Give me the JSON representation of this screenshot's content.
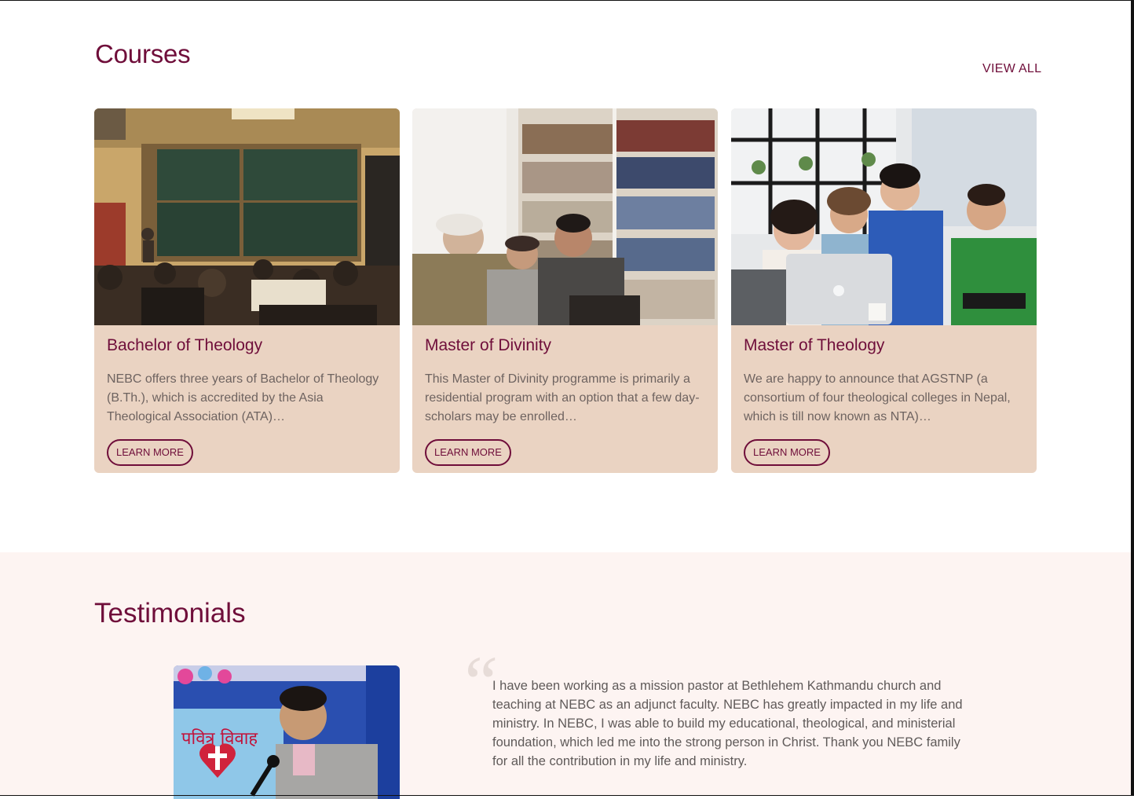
{
  "courses": {
    "title": "Courses",
    "view_all_label": "VIEW ALL",
    "items": [
      {
        "title": "Bachelor of Theology",
        "description": "NEBC offers three years of Bachelor of Theology (B.Th.), which is accredited by the Asia Theological Association (ATA)…",
        "button_label": "LEARN MORE"
      },
      {
        "title": "Master of Divinity",
        "description": "This Master of Divinity programme is primarily a residential program with an option that a few day-scholars may be enrolled…",
        "button_label": "LEARN MORE"
      },
      {
        "title": "Master of Theology",
        "description": "We are happy to announce that AGSTNP (a consortium of four theological colleges in Nepal, which is till now known as NTA)…",
        "button_label": "LEARN MORE"
      }
    ]
  },
  "testimonials": {
    "title": "Testimonials",
    "quote_mark": "“",
    "quote": "I have been working as a mission pastor at Bethlehem Kathmandu church and teaching at NEBC as an adjunct faculty. NEBC has greatly impacted in my life and ministry. In NEBC, I was able to build my educational, theological, and ministerial foundation, which led me into the strong person in Christ. Thank you NEBC family for all the contribution in my life and ministry.",
    "photo_banner_text": "पवित्र विवाह"
  },
  "colors": {
    "brand": "#6f0e3a",
    "card_bg": "#ead3c2",
    "testimonial_bg": "#fdf4f2",
    "body_text": "#6e6360"
  }
}
